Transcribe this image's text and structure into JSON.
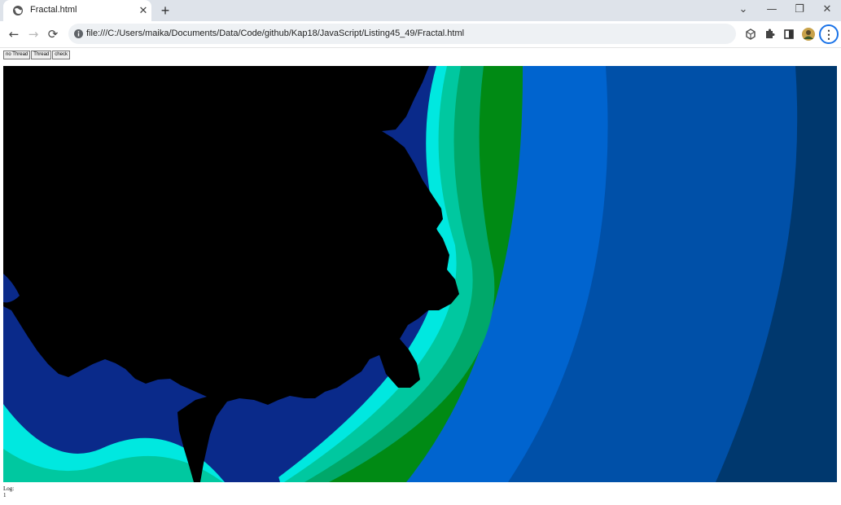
{
  "browser": {
    "tab": {
      "title": "Fractal.html",
      "favicon": "globe-icon",
      "close_glyph": "✕"
    },
    "new_tab_glyph": "+",
    "window_controls": {
      "tab_search": "⌄",
      "minimize": "—",
      "restore": "❐",
      "close": "✕"
    },
    "nav": {
      "back": "←",
      "forward": "→",
      "reload": "⟳"
    },
    "address": {
      "url": "file:///C:/Users/maika/Documents/Data/Code/github/Kap18/JavaScript/Listing45_49/Fractal.html",
      "icon": "site-info-icon"
    },
    "toolbar_icons": [
      "extension-cube-icon",
      "puzzle-icon",
      "side-panel-icon",
      "profile-avatar-icon",
      "more-menu-icon"
    ],
    "menu_glyph": "⋮"
  },
  "page": {
    "buttons": {
      "no_thread": "no Thread",
      "thread": "Thread",
      "check": "check"
    },
    "log_label": "Log:",
    "log_value": "1"
  },
  "fractal": {
    "palette": [
      "#00386e",
      "#0050a8",
      "#0064cf",
      "#008a14",
      "#00a86a",
      "#00c8a0",
      "#00e8e0",
      "#0a2a8a",
      "#000000"
    ]
  }
}
